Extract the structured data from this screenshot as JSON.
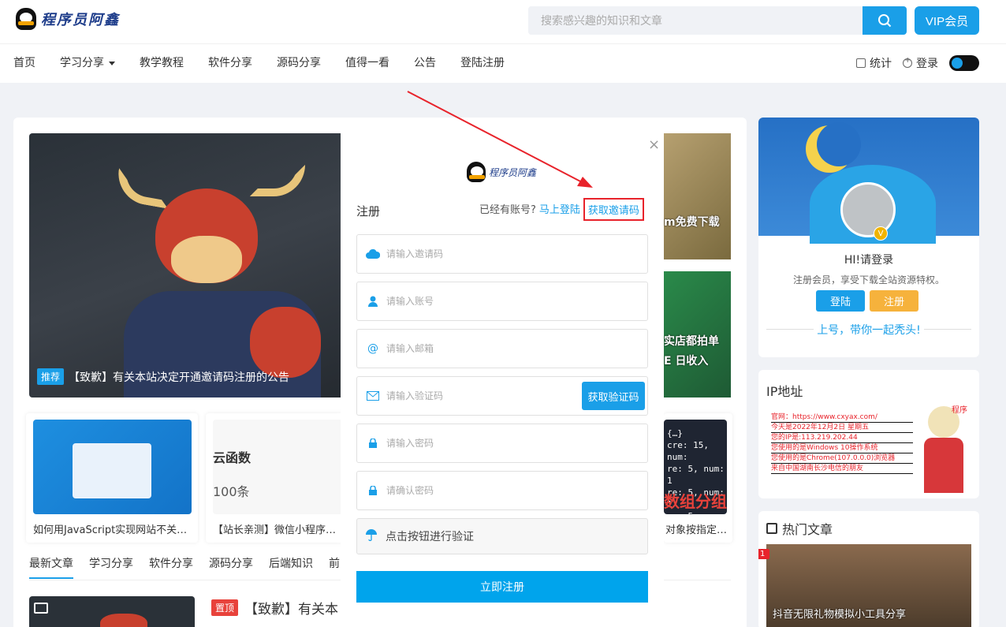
{
  "header": {
    "logo_text": "程序员阿鑫",
    "search_placeholder": "搜索感兴趣的知识和文章",
    "vip_label": "VIP会员",
    "nav": [
      "首页",
      "学习分享",
      "教学教程",
      "软件分享",
      "源码分享",
      "值得一看",
      "公告",
      "登陆注册"
    ],
    "stats_label": "统计",
    "login_label": "登录"
  },
  "slider": {
    "badge": "推荐",
    "caption": "【致歉】有关本站决定开通邀请码注册的公告",
    "side1_text": "m免费下载",
    "side2_text_1": "实店都拍单",
    "side2_text_2": "E 日收入"
  },
  "posts": [
    {
      "title": "如何用JavaScript实现网站不关闭..."
    },
    {
      "title": "【站长亲测】微信小程序云开发",
      "thumb_text_1": "云函数",
      "thumb_text_2": "100条"
    },
    {
      "title": "对象按指定…",
      "thumb_text": "数组分组"
    }
  ],
  "tabs": [
    "最新文章",
    "学习分享",
    "软件分享",
    "源码分享",
    "后端知识",
    "前"
  ],
  "latest": {
    "badge": "置顶",
    "title": "【致歉】有关本"
  },
  "modal": {
    "logo_text": "程序员阿鑫",
    "heading": "注册",
    "have_account": "已经有账号?",
    "login_link": "马上登陆",
    "invite_link": "获取邀请码",
    "invite_placeholder": "请输入邀请码",
    "account_placeholder": "请输入账号",
    "email_placeholder": "请输入邮箱",
    "code_placeholder": "请输入验证码",
    "get_code_label": "获取验证码",
    "password_placeholder": "请输入密码",
    "confirm_placeholder": "请确认密码",
    "verify_label": "点击按钮进行验证",
    "submit_label": "立即注册"
  },
  "sidebar": {
    "greeting": "HI!请登录",
    "greeting_sub": "注册会员，享受下载全站资源特权。",
    "login_label": "登陆",
    "register_label": "注册",
    "slogan": "上号，带你一起秃头!",
    "ip_title": "IP地址",
    "ip_lines": [
      "官网：https://www.cxyax.com/",
      "今天是2022年12月2日 星期五",
      "您的IP是:113.219.202.44",
      "您使用的是Windows 10操作系统",
      "您使用的是Chrome(107.0.0.0)浏览器",
      "来自中国湖南长沙电信的朋友"
    ],
    "ip_tag": "程序",
    "hot_title": "热门文章",
    "hot_rank": "1",
    "hot_caption": "抖音无限礼物模拟小工具分享"
  },
  "colors": {
    "accent": "#1a9fe8",
    "warning": "#f6b23c",
    "highlight": "#e8232b"
  }
}
